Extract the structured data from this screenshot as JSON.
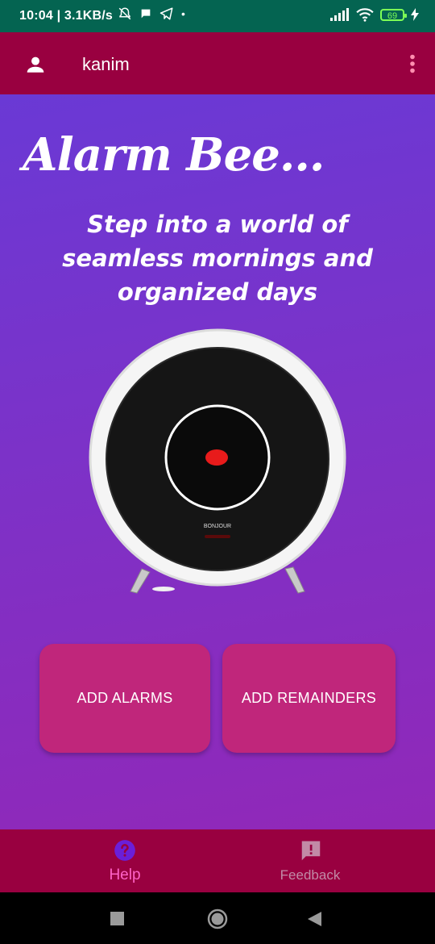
{
  "status_bar": {
    "time": "10:04",
    "speed": "3.1KB/s",
    "battery": "69"
  },
  "app_bar": {
    "title": "kanim",
    "user_icon": "person-icon",
    "menu_icon": "more-vert-icon"
  },
  "main": {
    "headline": "Alarm Bee...",
    "tagline": "Step into a world of seamless mornings and organized days",
    "clock_brand": "BONJOUR",
    "buttons": {
      "add_alarms": "ADD ALARMS",
      "add_reminders": "ADD REMAINDERS"
    }
  },
  "bottom_nav": {
    "items": [
      {
        "label": "Help",
        "icon": "help-icon",
        "active": true
      },
      {
        "label": "Feedback",
        "icon": "feedback-icon",
        "active": false
      }
    ]
  },
  "colors": {
    "status_bar": "#046451",
    "app_bar": "#990040",
    "button": "#c0267b",
    "active_nav": "#ff63c8",
    "nav_active_icon": "#6a1fd8"
  }
}
